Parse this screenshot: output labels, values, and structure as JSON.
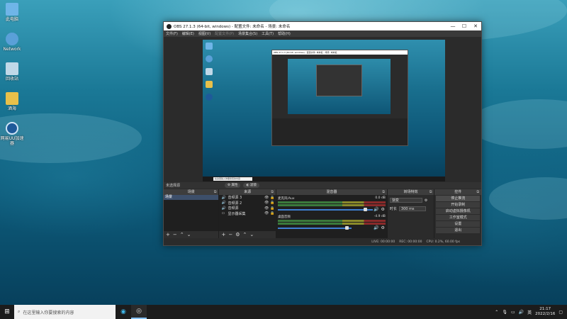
{
  "desktop": {
    "icons": [
      {
        "label": "此电脑",
        "icon": "computer-icon",
        "color": "#6fb5e8"
      },
      {
        "label": "Network",
        "icon": "network-icon",
        "color": "#5aa0d8"
      },
      {
        "label": "回收站",
        "icon": "recycle-bin-icon",
        "color": "#c0d8e8"
      },
      {
        "label": "酒海",
        "icon": "document-app-icon",
        "color": "#e8c04a"
      },
      {
        "label": "网易UU加速器",
        "icon": "uu-booster-icon",
        "color": "#1e5a9a"
      }
    ]
  },
  "obs": {
    "title": "OBS 27.1.3 (64-bit, windows) - 配置文件: 未命名 - 场景: 未命名",
    "menu": [
      "文件(F)",
      "编辑(E)",
      "视图(V)",
      "配置文件(P)",
      "场景集合(S)",
      "工具(T)",
      "帮助(H)"
    ],
    "preview": {
      "nested_title": "OBS 27.1.3 (64-bit, windows) - 配置文件: 未命名 - 场景: 未命名",
      "search_text": "在这里输入你要搜索的内容"
    },
    "status_strip": {
      "no_source": "未选择源",
      "properties": "属性",
      "filters": "滤镜"
    },
    "scenes": {
      "header": "场景",
      "items": [
        "场景"
      ]
    },
    "sources": {
      "header": "来源",
      "items": [
        {
          "label": "音频源 3",
          "icon": "audio-source-icon"
        },
        {
          "label": "音频源 2",
          "icon": "audio-source-icon"
        },
        {
          "label": "音频源",
          "icon": "audio-source-icon"
        },
        {
          "label": "显示器采集",
          "icon": "monitor-icon"
        }
      ]
    },
    "mixer": {
      "header": "混音器",
      "channels": [
        {
          "name": "麦克风/Aux",
          "db": "0.0 dB",
          "level": 0.95
        },
        {
          "name": "桌面音频",
          "db": "-4.9 dB",
          "level": 0.78
        }
      ]
    },
    "transitions": {
      "header": "转场特效",
      "selected": "渐变",
      "duration_label": "时长",
      "duration_value": "300 ms"
    },
    "controls": {
      "header": "控件",
      "buttons": [
        "停止推流",
        "开始录制",
        "启动虚拟摄像机",
        "工作室模式",
        "设置",
        "退出"
      ]
    },
    "statusbar": {
      "live": "LIVE: 00:00:00",
      "rec": "REC: 00:00:00",
      "cpu": "CPU: 0.2%, 60.00 fps"
    }
  },
  "taskbar": {
    "search_placeholder": "在这里输入你要搜索的内容",
    "time": "21:17",
    "date": "2022/2/16"
  },
  "colors": {
    "accent_blue": "#3e7fd1",
    "obs_bg": "#2b2b2b"
  }
}
